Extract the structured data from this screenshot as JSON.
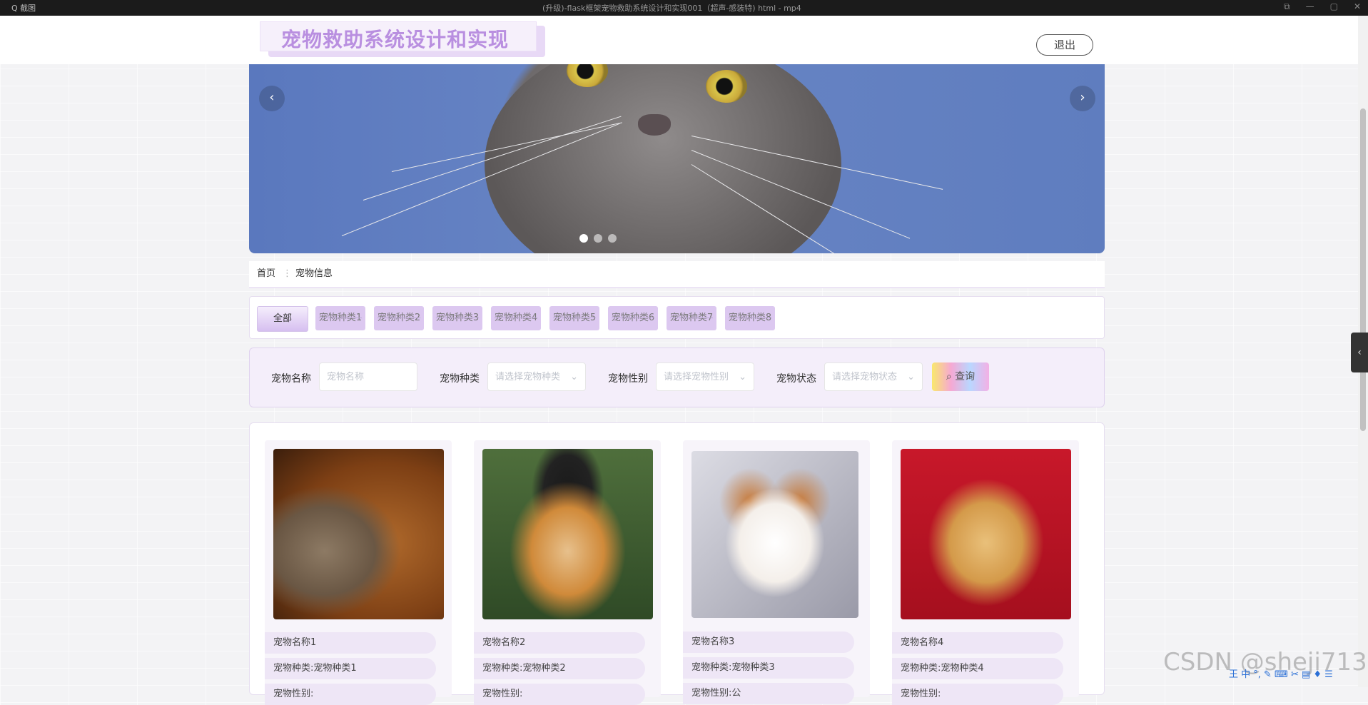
{
  "window": {
    "title": "(升级)-flask框架宠物救助系统设计和实现001（超声-感装特) html - mp4",
    "left_text": "Q 截图"
  },
  "header": {
    "site_title": "宠物救助系统设计和实现",
    "logout_label": "退出"
  },
  "carousel": {
    "prev_icon": "‹",
    "next_icon": "›",
    "slide_count": 3,
    "active_index": 0
  },
  "breadcrumb": {
    "home": "首页",
    "separator": "⋮",
    "current": "宠物信息"
  },
  "category_filter": {
    "items": [
      "全部",
      "宠物种类1",
      "宠物种类2",
      "宠物种类3",
      "宠物种类4",
      "宠物种类5",
      "宠物种类6",
      "宠物种类7",
      "宠物种类8"
    ]
  },
  "search": {
    "name_label": "宠物名称",
    "name_placeholder": "宠物名称",
    "type_label": "宠物种类",
    "type_placeholder": "请选择宠物种类",
    "gender_label": "宠物性别",
    "gender_placeholder": "请选择宠物性别",
    "status_label": "宠物状态",
    "status_placeholder": "请选择宠物状态",
    "query_label": "查询"
  },
  "pets": [
    {
      "name": "宠物名称1",
      "type": "宠物种类:宠物种类1",
      "gender": "宠物性别:"
    },
    {
      "name": "宠物名称2",
      "type": "宠物种类:宠物种类2",
      "gender": "宠物性别:"
    },
    {
      "name": "宠物名称3",
      "type": "宠物种类:宠物种类3",
      "gender": "宠物性别:公"
    },
    {
      "name": "宠物名称4",
      "type": "宠物种类:宠物种类4",
      "gender": "宠物性别:"
    }
  ],
  "watermark": "CSDN @sheji713",
  "ime_bar": "王 中 °, ✎ ⌨ ✂ ▤ ♦ ☰",
  "colors": {
    "accent": "#b98fe0",
    "category_bg": "#dcc8f0",
    "search_bg": "#f4eefa"
  }
}
